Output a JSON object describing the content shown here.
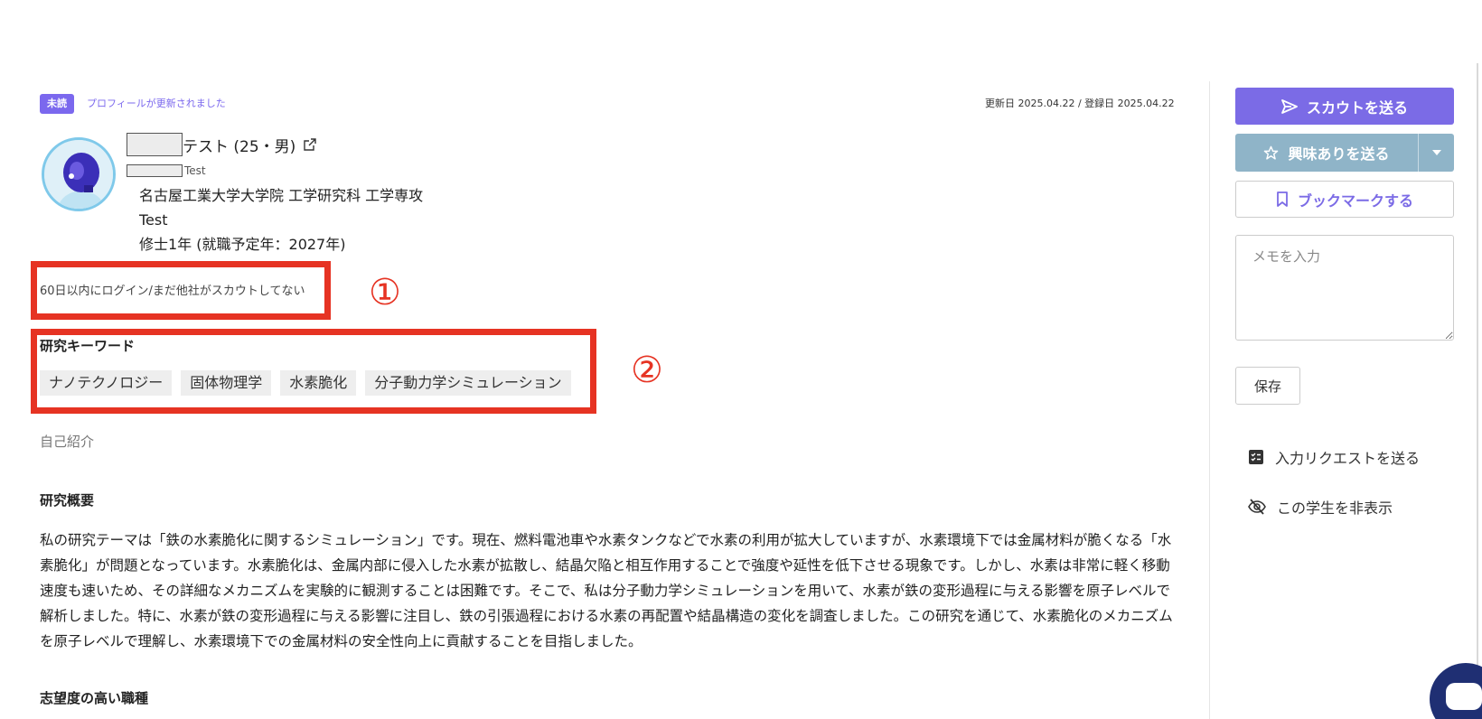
{
  "header": {
    "unread_badge": "未読",
    "update_notice": "プロフィールが更新されました",
    "dates": "更新日 2025.04.22 / 登録日 2025.04.22"
  },
  "profile": {
    "name_suffix": "テスト (25・男)",
    "kana_suffix": "Test",
    "school": "名古屋工業大学大学院 工学研究科 工学専攻",
    "department": "Test",
    "grade": "修士1年 (就職予定年：2027年)"
  },
  "annotations": {
    "marker_1": "①",
    "marker_2": "②"
  },
  "status": {
    "login_status": "60日以内にログイン/まだ他社がスカウトしてない"
  },
  "keywords": {
    "title": "研究キーワード",
    "items": [
      "ナノテクノロジー",
      "固体物理学",
      "水素脆化",
      "分子動力学シミュレーション"
    ]
  },
  "sections": {
    "intro_label": "自己紹介",
    "overview_title": "研究概要",
    "overview_body": "私の研究テーマは「鉄の水素脆化に関するシミュレーション」です。現在、燃料電池車や水素タンクなどで水素の利用が拡大していますが、水素環境下では金属材料が脆くなる「水素脆化」が問題となっています。水素脆化は、金属内部に侵入した水素が拡散し、結晶欠陥と相互作用することで強度や延性を低下させる現象です。しかし、水素は非常に軽く移動速度も速いため、その詳細なメカニズムを実験的に観測することは困難です。そこで、私は分子動力学シミュレーションを用いて、水素が鉄の変形過程に与える影響を原子レベルで解析しました。特に、水素が鉄の変形過程に与える影響に注目し、鉄の引張過程における水素の再配置や結晶構造の変化を調査しました。この研究を通じて、水素脆化のメカニズムを原子レベルで理解し、水素環境下での金属材料の安全性向上に貢献することを目指しました。",
    "wish_title": "志望度の高い職種"
  },
  "sidebar": {
    "scout_label": "スカウトを送る",
    "interest_label": "興味ありを送る",
    "bookmark_label": "ブックマークする",
    "memo_placeholder": "メモを入力",
    "save_label": "保存",
    "input_request_label": "入力リクエストを送る",
    "hide_label": "この学生を非表示"
  },
  "colors": {
    "accent": "#7b6be6",
    "interest_button": "#8fb4c8",
    "annotation_red": "#e63323"
  }
}
